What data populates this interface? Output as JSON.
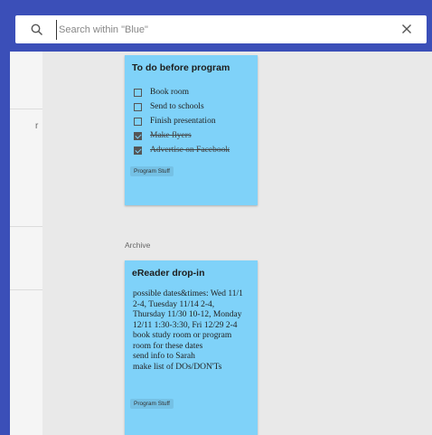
{
  "search": {
    "placeholder": "Search within \"Blue\""
  },
  "sidebar": {
    "partial_char": "r"
  },
  "notes": [
    {
      "title": "To do before program",
      "items": [
        {
          "label": "Book room",
          "checked": false
        },
        {
          "label": "Send to schools",
          "checked": false
        },
        {
          "label": "Finish presentation",
          "checked": false
        },
        {
          "label": "Make flyers",
          "checked": true
        },
        {
          "label": "Advertise on Facebook",
          "checked": true
        }
      ],
      "label": "Program Stuff",
      "color": "#7fd2f9"
    },
    {
      "title": "eReader drop-in",
      "body_lines": [
        "possible dates&times: Wed 11/1",
        "2-4, Tuesday 11/14 2-4,",
        "Thursday 11/30 10-12, Monday",
        "12/11 1:30-3:30, Fri 12/29 2-4",
        "book study room or program",
        "room for these dates",
        "send info to Sarah",
        "make list of DOs/DON'Ts"
      ],
      "label": "Program Stuff",
      "color": "#7fd2f9"
    }
  ],
  "archive_label": "Archive",
  "colors": {
    "topbar": "#3b4fb8",
    "note": "#7fd2f9",
    "background": "#e9e9e9"
  }
}
